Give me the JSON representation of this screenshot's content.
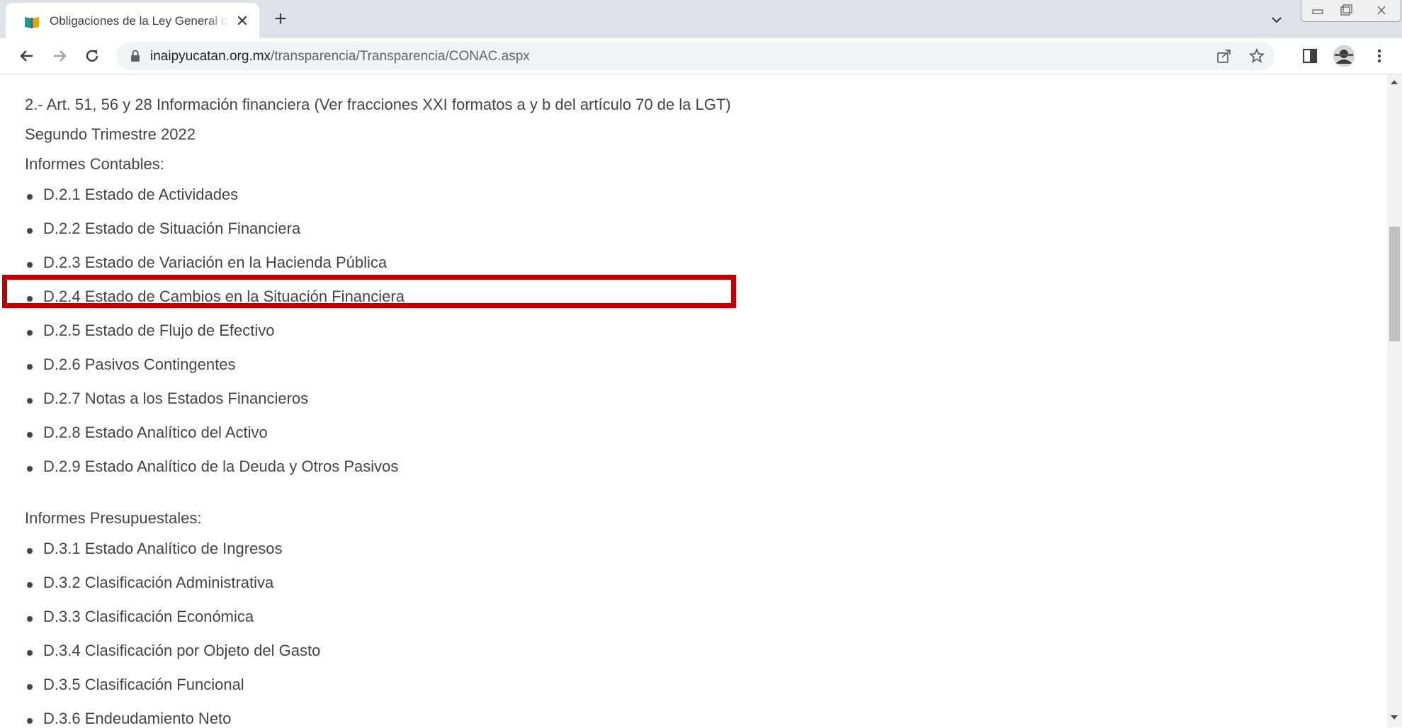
{
  "browser": {
    "tab_title": "Obligaciones de la Ley General de Transparencia",
    "close_tab_glyph": "✕",
    "new_tab_glyph": "+",
    "url_host": "inaipyucatan.org.mx",
    "url_path": "/transparencia/Transparencia/CONAC.aspx",
    "icons": [
      "back-icon",
      "forward-icon",
      "reload-icon",
      "lock-icon",
      "share-icon",
      "star-icon",
      "side-panel-icon",
      "profile-avatar",
      "menu-icon",
      "tab-search-icon",
      "minimize-icon",
      "restore-icon",
      "close-window-icon"
    ]
  },
  "page": {
    "heading": "2.- Art. 51, 56 y 28 Información financiera (Ver fracciones XXI formatos a y b del artículo 70 de la LGT)",
    "period": "Segundo Trimestre 2022",
    "contables_title": "Informes Contables:",
    "contables": [
      "D.2.1 Estado de Actividades",
      "D.2.2 Estado de Situación Financiera",
      "D.2.3 Estado de Variación en la Hacienda Pública",
      "D.2.4 Estado de Cambios en la Situación Financiera",
      "D.2.5 Estado de Flujo de Efectivo",
      "D.2.6 Pasivos Contingentes",
      "D.2.7 Notas a los Estados Financieros",
      "D.2.8 Estado Analítico del Activo",
      "D.2.9 Estado Analítico de la Deuda y Otros Pasivos"
    ],
    "presupuestales_title": "Informes Presupuestales:",
    "presupuestales": [
      "D.3.1 Estado Analítico de Ingresos",
      "D.3.2 Clasificación Administrativa",
      "D.3.3 Clasificación Económica",
      "D.3.4 Clasificación por Objeto del Gasto",
      "D.3.5 Clasificación Funcional",
      "D.3.6 Endeudamiento Neto"
    ]
  },
  "colors": {
    "highlight_border": "#c00000",
    "text": "#444444",
    "chrome_bg": "#dee1e6"
  }
}
